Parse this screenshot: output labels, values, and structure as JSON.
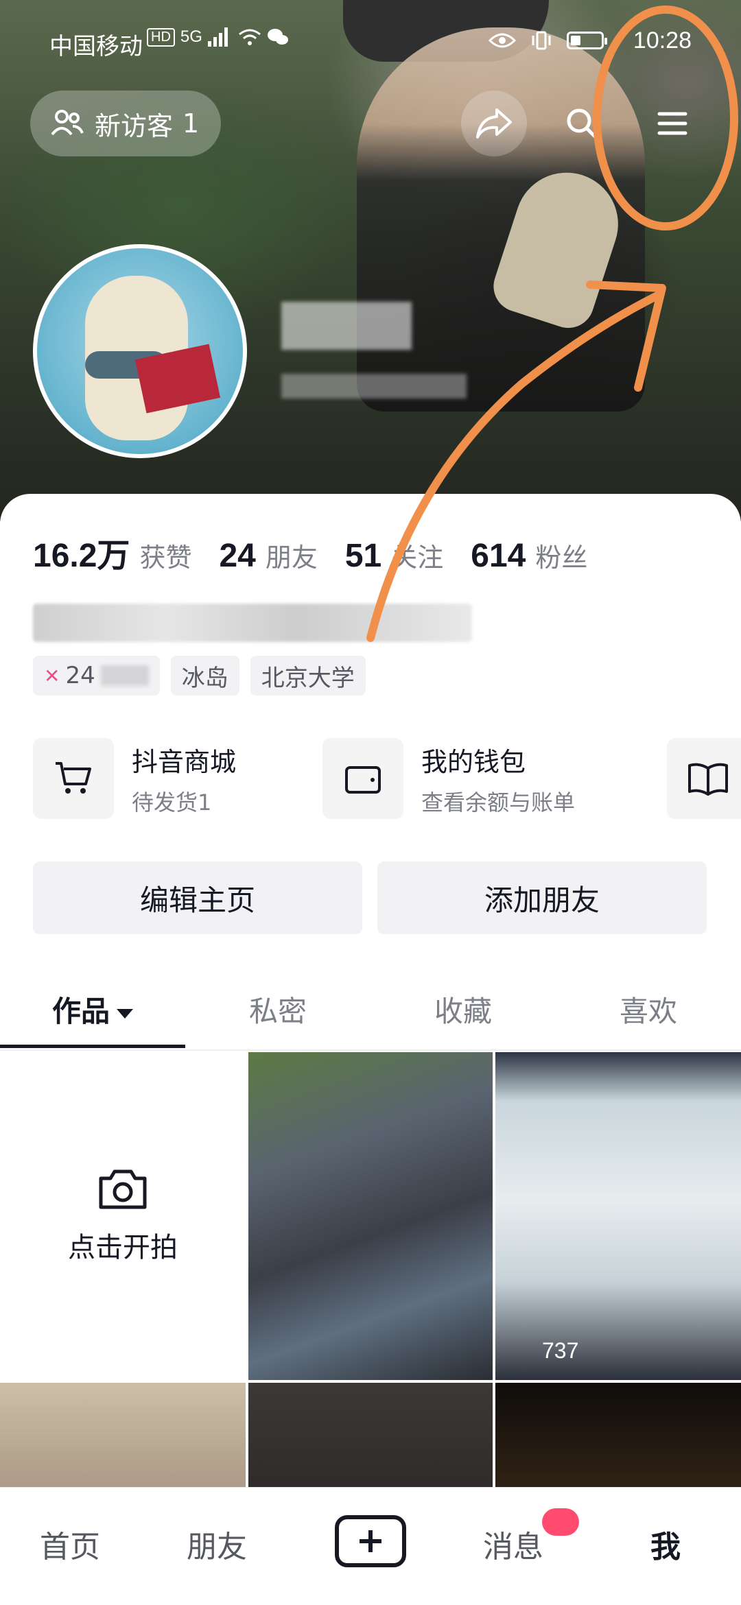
{
  "status_bar": {
    "carrier": "中国移动",
    "hd": "HD",
    "signal": "5G",
    "time": "10:28"
  },
  "header": {
    "visitor_label": "新访客",
    "visitor_count": "1",
    "icons": [
      "people-icon",
      "share-icon",
      "search-icon",
      "menu-icon"
    ]
  },
  "stats": [
    {
      "value": "16.2万",
      "label": "获赞"
    },
    {
      "value": "24",
      "label": "朋友"
    },
    {
      "value": "51",
      "label": "关注"
    },
    {
      "value": "614",
      "label": "粉丝"
    }
  ],
  "tags": {
    "age": "24",
    "location": "冰岛",
    "school": "北京大学"
  },
  "tools": {
    "mall_title": "抖音商城",
    "mall_sub": "待发货1",
    "wallet_title": "我的钱包",
    "wallet_sub": "查看余额与账单"
  },
  "buttons": {
    "edit": "编辑主页",
    "add_friend": "添加朋友"
  },
  "tabs": [
    "作品",
    "私密",
    "收藏",
    "喜欢"
  ],
  "grid": {
    "shoot_label": "点击开拍",
    "count_2": "737"
  },
  "bottom_nav": [
    "首页",
    "朋友",
    "消息",
    "我"
  ],
  "colors": {
    "annotation": "#f0904a",
    "accent": "#fe2c55",
    "text": "#161823"
  }
}
